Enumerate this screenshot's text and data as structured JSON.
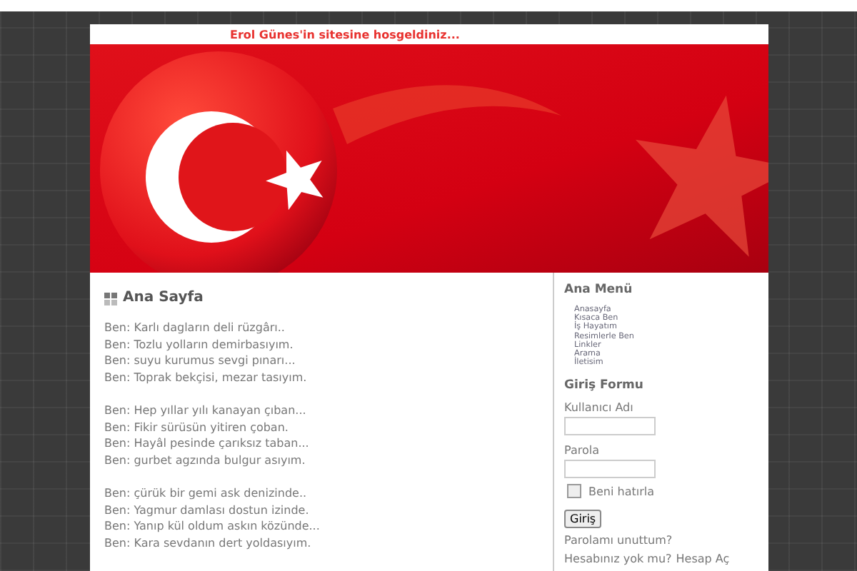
{
  "header": {
    "welcome": "Erol Günes'in sitesine hosgeldiniz..."
  },
  "main": {
    "title": "Ana Sayfa",
    "stanzas": [
      [
        "Ben: Karlı dagların deli rüzgârı..",
        "Ben: Tozlu yolların demirbasıyım.",
        "Ben: suyu kurumus sevgi pınarı...",
        "Ben: Toprak bekçisi, mezar tasıyım."
      ],
      [
        "Ben: Hep yıllar yılı kanayan çıban...",
        "Ben: Fikir sürüsün yitiren çoban.",
        "Ben: Hayâl pesinde çarıksız taban...",
        "Ben: gurbet agzında bulgur asıyım."
      ],
      [
        "Ben: çürük bir gemi ask denizinde..",
        "Ben: Yagmur damlası dostun izinde.",
        "Ben: Yanıp kül oldum askın közünde...",
        "Ben: Kara sevdanın dert yoldasıyım."
      ]
    ]
  },
  "sidebar": {
    "menu_title": "Ana Menü",
    "menu_items": [
      "Anasayfa",
      "Kısaca Ben",
      "İş Hayatım",
      "Resimlerle Ben",
      "Linkler",
      "Arama",
      "İletisim"
    ],
    "login": {
      "title": "Giriş Formu",
      "fields": [
        {
          "label": "Kullanıcı Adı"
        },
        {
          "label": "Parola"
        }
      ],
      "remember": {
        "label": "Beni hatırla",
        "checked": false
      },
      "button": "Giriş",
      "forgot": "Parolamı unuttum?",
      "register_prompt": "Hesabınız yok mu?",
      "register_link": "Hesap Aç"
    }
  }
}
